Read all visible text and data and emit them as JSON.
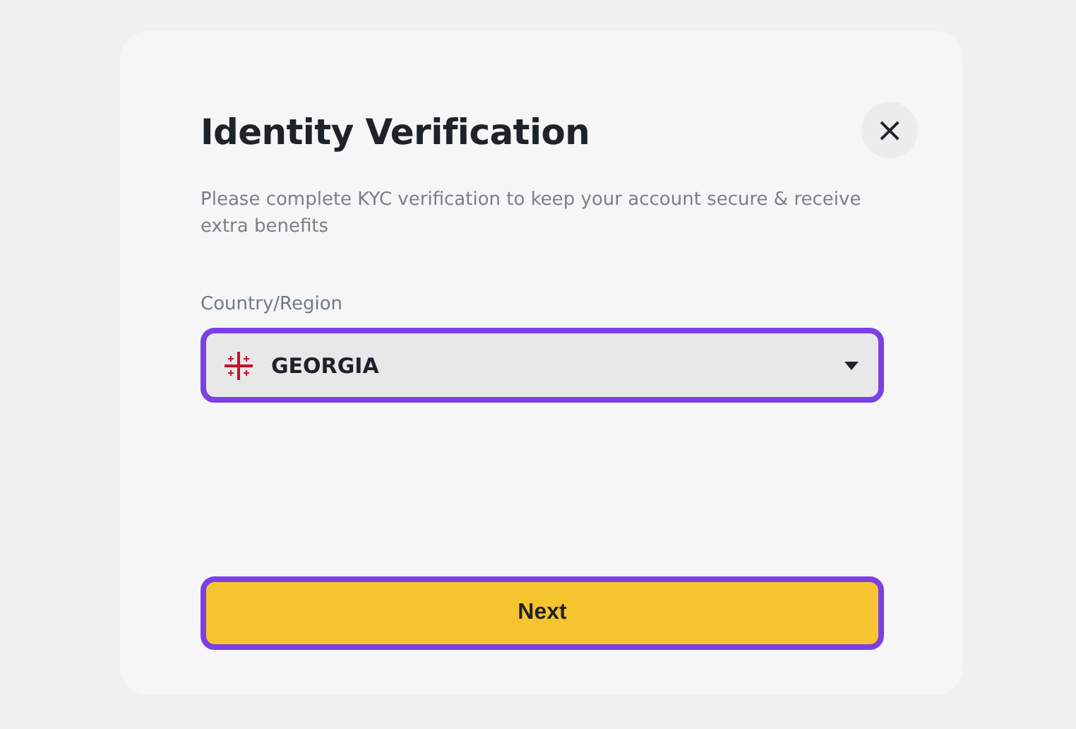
{
  "dialog": {
    "title": "Identity Verification",
    "close": "×",
    "description": "Please complete KYC verification to keep your account secure & receive extra benefits"
  },
  "country_field": {
    "label": "Country/Region",
    "value": "GEORGIA",
    "highlighted": true
  },
  "next_button": {
    "label": "Next",
    "highlighted": true
  }
}
